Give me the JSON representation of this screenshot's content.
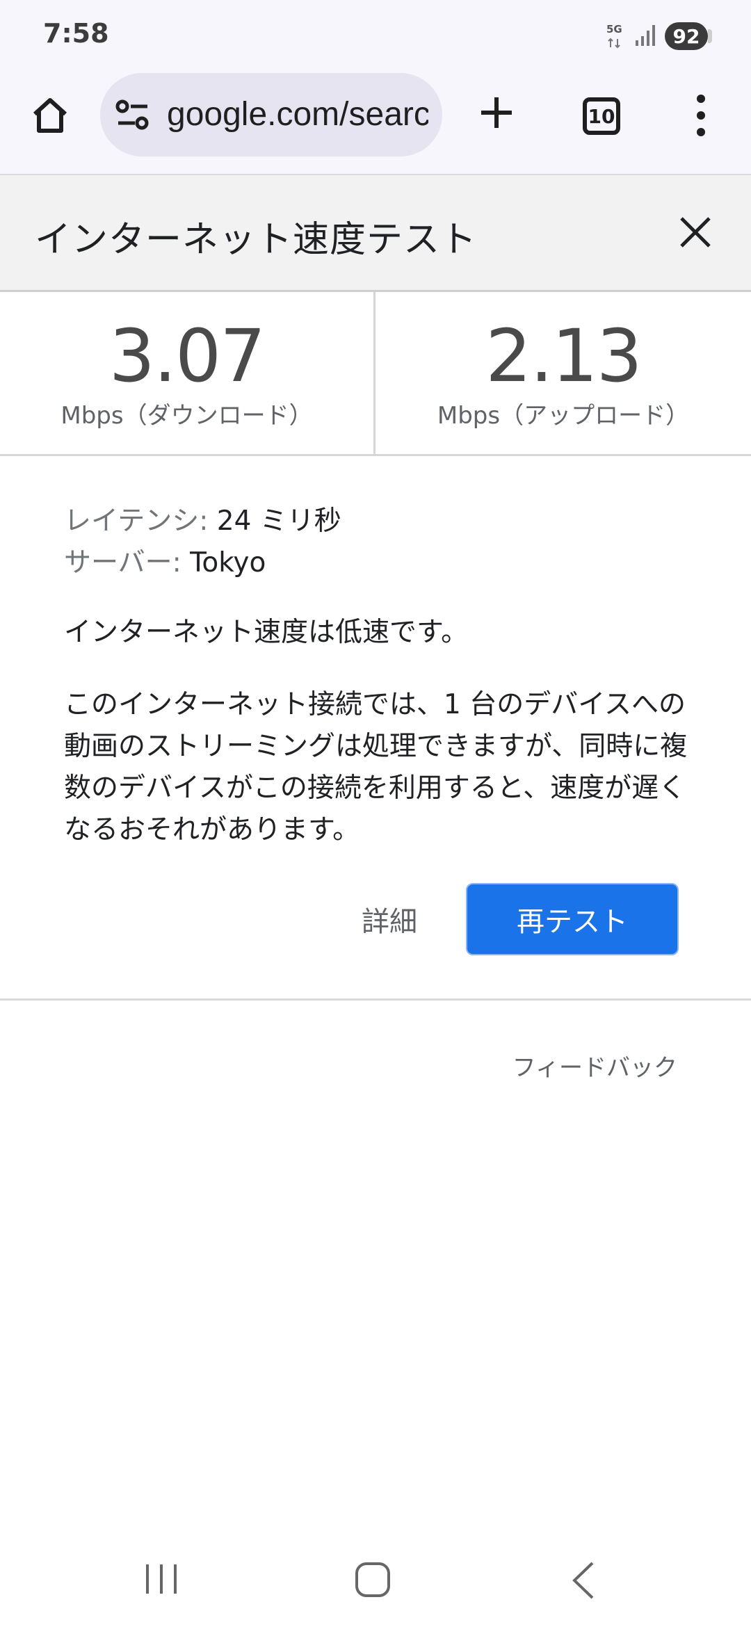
{
  "status_bar": {
    "time": "7:58",
    "network": "5G",
    "battery": "92"
  },
  "browser": {
    "url": "google.com/search",
    "tab_count": "10",
    "icons": {
      "home": "home-icon",
      "site_settings": "tune-icon",
      "new_tab": "plus-icon",
      "menu": "more-vert-icon"
    }
  },
  "panel": {
    "title": "インターネット速度テスト",
    "download": {
      "value": "3.07",
      "label": "Mbps（ダウンロード）"
    },
    "upload": {
      "value": "2.13",
      "label": "Mbps（アップロード）"
    },
    "latency_key": "レイテンシ:",
    "latency_value": "24 ミリ秒",
    "server_key": "サーバー:",
    "server_value": "Tokyo",
    "summary": "インターネット速度は低速です。",
    "description": "このインターネット接続では、1 台のデバイスへの動画のストリーミングは処理できますが、同時に複数のデバイスがこの接続を利用すると、速度が遅くなるおそれがあります。",
    "details_button": "詳細",
    "retest_button": "再テスト",
    "feedback": "フィードバック"
  },
  "colors": {
    "accent": "#1a73e8",
    "toolbar_bg": "#f7f6fc",
    "omnibox_bg": "#e6e4f0",
    "header_bg": "#f2f2f3"
  }
}
